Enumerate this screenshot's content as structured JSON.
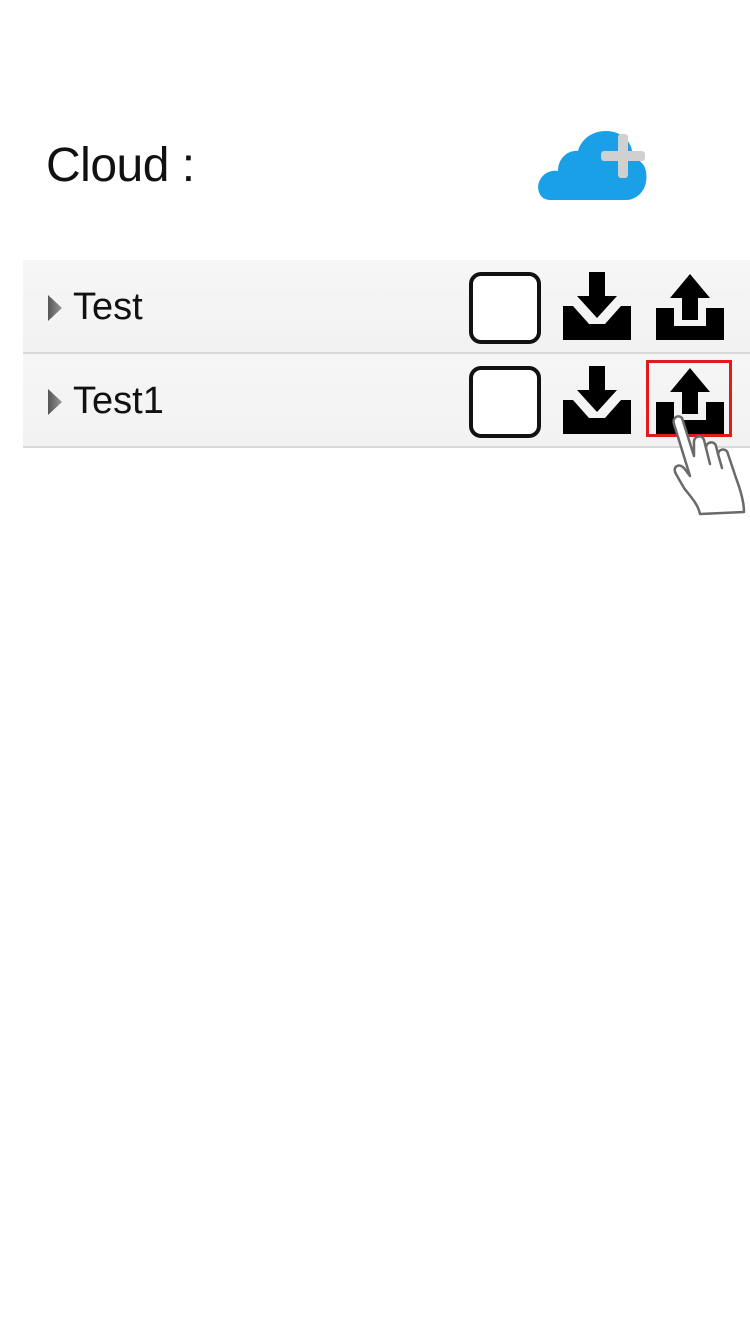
{
  "header": {
    "title": "Cloud :",
    "add_cloud_icon": "cloud-plus-icon",
    "cloud_color": "#1aa0e6",
    "plus_color": "#d0d0d0"
  },
  "folders": [
    {
      "label": "Test",
      "checked": false,
      "expand_icon": "triangle-right-icon",
      "download_icon": "download-tray-icon",
      "upload_icon": "upload-tray-icon"
    },
    {
      "label": "Test1",
      "checked": false,
      "expand_icon": "triangle-right-icon",
      "download_icon": "download-tray-icon",
      "upload_icon": "upload-tray-icon"
    }
  ],
  "annotation": {
    "highlight_color": "#e01b1b",
    "highlighted_control": "upload button of Test1",
    "pointer_icon": "tap-hand-icon"
  }
}
